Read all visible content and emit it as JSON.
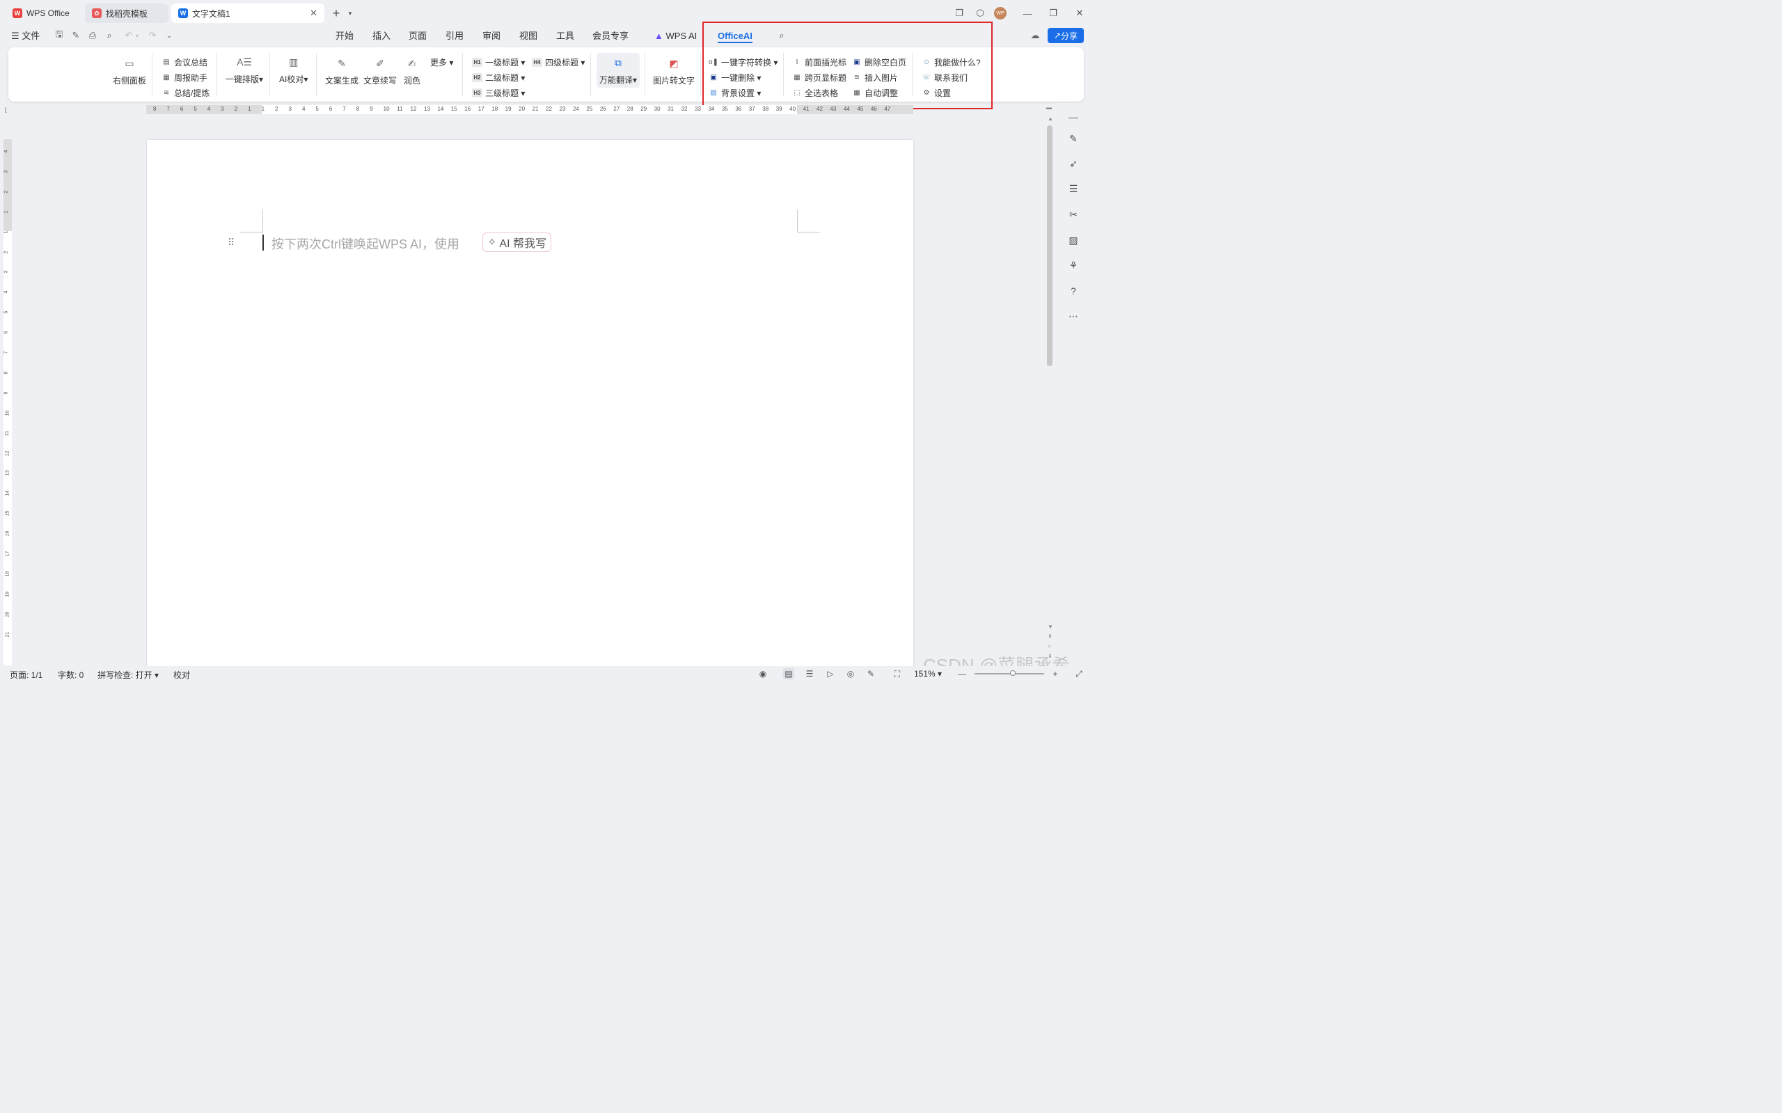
{
  "tabs": [
    {
      "label": "WPS Office",
      "icon": "wps-logo-icon"
    },
    {
      "label": "找稻壳模板",
      "icon": "docer-icon"
    },
    {
      "label": "文字文稿1",
      "icon": "writer-icon"
    }
  ],
  "user_avatar": "WP",
  "menu": {
    "file": "文件",
    "items": [
      "开始",
      "插入",
      "页面",
      "引用",
      "审阅",
      "视图",
      "工具",
      "会员专享",
      "WPS AI",
      "OfficeAI"
    ],
    "share": "分享"
  },
  "ribbon": {
    "right_panel": "右侧面板",
    "meeting_summary": "会议总结",
    "weekly_helper": "周报助手",
    "summarize": "总结/提炼",
    "one_click_layout": "一键排版",
    "ai_proofread": "AI校对",
    "copy_gen": "文案生成",
    "article_continue": "文章续写",
    "polish": "润色",
    "more": "更多",
    "h1": "一级标题",
    "h2": "二级标题",
    "h3": "三级标题",
    "h4": "四级标题",
    "translate": "万能翻译",
    "img_to_text": "图片转文字",
    "char_convert": "一键字符转换",
    "one_click_delete": "一键删除",
    "background": "背景设置",
    "insert_cursor": "前面插光标",
    "cross_page_title": "跨页显标题",
    "select_all_tables": "全选表格",
    "delete_blank": "删除空白页",
    "insert_image": "插入图片",
    "auto_adjust": "自动调整",
    "what_can_i_do": "我能做什么?",
    "contact": "联系我们",
    "settings": "设置"
  },
  "ruler_h": [
    "8",
    "7",
    "6",
    "5",
    "4",
    "3",
    "2",
    "1",
    "1",
    "2",
    "3",
    "4",
    "5",
    "6",
    "7",
    "8",
    "9",
    "10",
    "11",
    "12",
    "13",
    "14",
    "15",
    "16",
    "17",
    "18",
    "19",
    "20",
    "21",
    "22",
    "23",
    "24",
    "25",
    "26",
    "27",
    "28",
    "29",
    "30",
    "31",
    "32",
    "33",
    "34",
    "35",
    "36",
    "37",
    "38",
    "39",
    "40",
    "41",
    "42",
    "43",
    "44",
    "45",
    "46",
    "47"
  ],
  "ruler_v": [
    "4",
    "3",
    "2",
    "1",
    "1",
    "2",
    "3",
    "4",
    "5",
    "6",
    "7",
    "8",
    "9",
    "10",
    "11",
    "12",
    "13",
    "14",
    "15",
    "16",
    "17",
    "18",
    "19",
    "20",
    "21"
  ],
  "document": {
    "hint": "按下两次Ctrl键唤起WPS AI，使用",
    "ai_button": "AI 帮我写"
  },
  "status": {
    "page": "页面: 1/1",
    "words": "字数: 0",
    "spell": "拼写检查: 打开",
    "proof": "校对",
    "zoom": "151%"
  },
  "watermark": "CSDN @菜腿承希",
  "colors": {
    "accent": "#1a6fe8",
    "highlight": "#e0262b",
    "wps_red": "#e8403d"
  }
}
